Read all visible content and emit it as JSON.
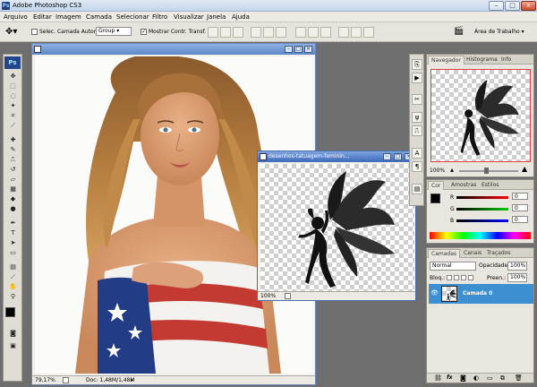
{
  "app": {
    "title": "Adobe Photoshop CS3"
  },
  "menu": [
    "Arquivo",
    "Editar",
    "Imagem",
    "Camada",
    "Selecionar",
    "Filtro",
    "Visualizar",
    "Janela",
    "Ajuda"
  ],
  "options": {
    "auto_select_label": "Selec. Camada Autom.:",
    "auto_select_value": "Group",
    "show_transform_label": "Mostrar Contr. Transf.",
    "workspace_label": "Área de Trabalho"
  },
  "doc1": {
    "zoom": "79,17%",
    "doc_info": "Doc: 1,48M/1,48M"
  },
  "doc2": {
    "title": "desenhos-tatuagem-feminin...",
    "zoom": "100%"
  },
  "navigator": {
    "tabs": [
      "Navegador",
      "Histograma",
      "Info"
    ],
    "zoom": "100%"
  },
  "color": {
    "tabs": [
      "Cor",
      "Amostras",
      "Estilos"
    ],
    "channels": [
      {
        "label": "R",
        "value": "0"
      },
      {
        "label": "G",
        "value": "0"
      },
      {
        "label": "B",
        "value": "0"
      }
    ]
  },
  "layers": {
    "tabs": [
      "Camadas",
      "Canais",
      "Traçados"
    ],
    "blend_mode": "Normal",
    "opacity_label": "Opacidade:",
    "opacity_value": "100%",
    "lock_label": "Bloq.:",
    "fill_label": "Preen.:",
    "fill_value": "100%",
    "layer_name": "Camada 0"
  },
  "colors": {
    "accent": "#3c8fd0",
    "title_bar": "#5d86c7"
  }
}
